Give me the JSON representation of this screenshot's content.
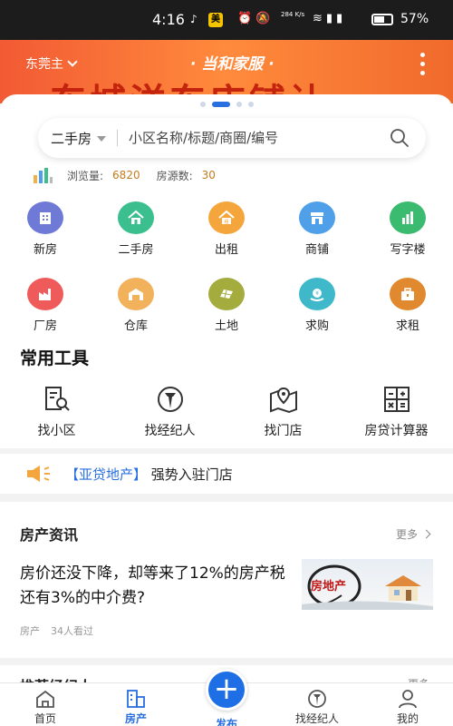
{
  "status_bar": {
    "time": "4:16",
    "speed": "284 K/s",
    "battery": "57%"
  },
  "banner": {
    "city": "东莞主",
    "slogan": "· 当和家服 ·",
    "big_text": "东城洋东店铺让"
  },
  "carousel": {
    "count": 4,
    "active": 1
  },
  "search": {
    "type": "二手房",
    "placeholder": "小区名称/标题/商圈/编号"
  },
  "stats": {
    "views_label": "浏览量:",
    "views": "6820",
    "listings_label": "房源数:",
    "listings": "30"
  },
  "categories": [
    {
      "label": "新房",
      "icon": "building-icon",
      "color": "#6f7ad6"
    },
    {
      "label": "二手房",
      "icon": "house-icon",
      "color": "#3cbf8e"
    },
    {
      "label": "出租",
      "icon": "rent-icon",
      "color": "#f4a63c"
    },
    {
      "label": "商铺",
      "icon": "shop-icon",
      "color": "#4fa0e8"
    },
    {
      "label": "写字楼",
      "icon": "office-icon",
      "color": "#3bbb6f"
    },
    {
      "label": "厂房",
      "icon": "factory-icon",
      "color": "#ef5b5b"
    },
    {
      "label": "仓库",
      "icon": "warehouse-icon",
      "color": "#f1b25b"
    },
    {
      "label": "土地",
      "icon": "land-icon",
      "color": "#a3ac3d"
    },
    {
      "label": "求购",
      "icon": "buy-request-icon",
      "color": "#3fb8c9"
    },
    {
      "label": "求租",
      "icon": "rent-request-icon",
      "color": "#e0892f"
    }
  ],
  "tools": {
    "title": "常用工具",
    "items": [
      {
        "label": "找小区",
        "icon": "find-community-icon"
      },
      {
        "label": "找经纪人",
        "icon": "agent-icon"
      },
      {
        "label": "找门店",
        "icon": "store-map-icon"
      },
      {
        "label": "房贷计算器",
        "icon": "calculator-icon"
      }
    ]
  },
  "notice": {
    "highlight": "【亚贷地产】",
    "text": " 强势入驻门店"
  },
  "news": {
    "title": "房产资讯",
    "more": "更多",
    "article": {
      "title": "房价还没下降，却等来了12%的房产税还有3%的中介费?",
      "tag": "房产",
      "views": "34人看过",
      "thumb_label": "房地产"
    }
  },
  "next_section": {
    "title": "推荐经纪人",
    "more": "更多"
  },
  "tabbar": [
    {
      "label": "首页",
      "icon": "home-icon"
    },
    {
      "label": "房产",
      "icon": "property-icon"
    },
    {
      "label": "发布",
      "icon": "plus-icon"
    },
    {
      "label": "找经纪人",
      "icon": "agent-icon"
    },
    {
      "label": "我的",
      "icon": "user-icon"
    }
  ],
  "colors": {
    "accent": "#2a6fe0",
    "banner": "#f25a34",
    "stat_number": "#c47b1e"
  }
}
